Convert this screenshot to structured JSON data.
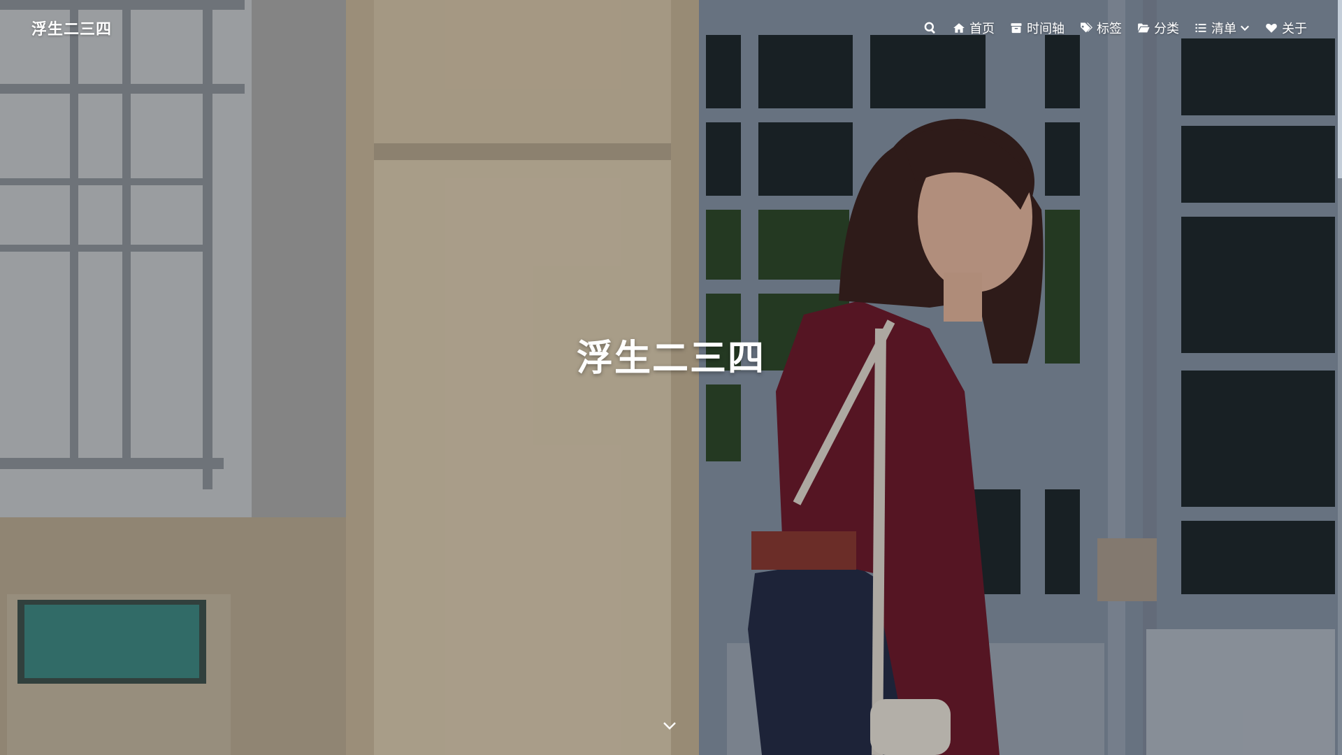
{
  "site": {
    "name": "浮生二三四",
    "title": "浮生二三四"
  },
  "nav": {
    "search_icon": "search-icon",
    "items": [
      {
        "label": "首页",
        "icon": "home-icon"
      },
      {
        "label": "时间轴",
        "icon": "archive-icon"
      },
      {
        "label": "标签",
        "icon": "tags-icon"
      },
      {
        "label": "分类",
        "icon": "folder-open-icon"
      },
      {
        "label": "清单",
        "icon": "list-icon",
        "dropdown": true
      },
      {
        "label": "关于",
        "icon": "heart-icon"
      }
    ]
  },
  "hero": {
    "scroll_icon": "chevron-down-icon"
  },
  "colors": {
    "text": "#ffffff",
    "overlay": "rgba(0,0,0,0.22)"
  }
}
